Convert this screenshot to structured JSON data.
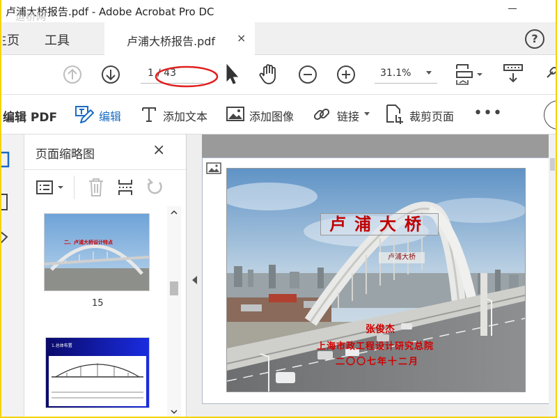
{
  "window": {
    "title": "卢浦大桥报告.pdf - Adobe Acrobat Pro DC",
    "watermark": "运桥网"
  },
  "tabs": {
    "home_label": "主页",
    "tools_label": "工具",
    "doc_label": "卢浦大桥报告.pdf",
    "close_glyph": "×",
    "help_glyph": "?"
  },
  "nav": {
    "current_page": "1",
    "total_pages": "/ 43",
    "zoom": "31.1%"
  },
  "editbar": {
    "title": "编辑 PDF",
    "edit": "编辑",
    "add_text": "添加文本",
    "add_image": "添加图像",
    "link": "链接",
    "crop": "裁剪页面",
    "more": "•••"
  },
  "panel": {
    "title": "页面缩略图",
    "close_glyph": "×",
    "thumbnails": [
      {
        "page_label": "15",
        "caption": "二、卢浦大桥设计特点"
      },
      {
        "page_label": "",
        "caption": "1.总体布置"
      }
    ]
  },
  "slide": {
    "title": "卢浦大桥",
    "subtitle": "卢浦大桥",
    "author": "张俊杰",
    "organization": "上海市政工程设计研究总院",
    "date": "二〇〇七年十二月"
  },
  "colors": {
    "accent": "#1a6bc4",
    "annotation_red": "#e02020",
    "frame_yellow": "#f4d400",
    "slide_red": "#d00000"
  }
}
